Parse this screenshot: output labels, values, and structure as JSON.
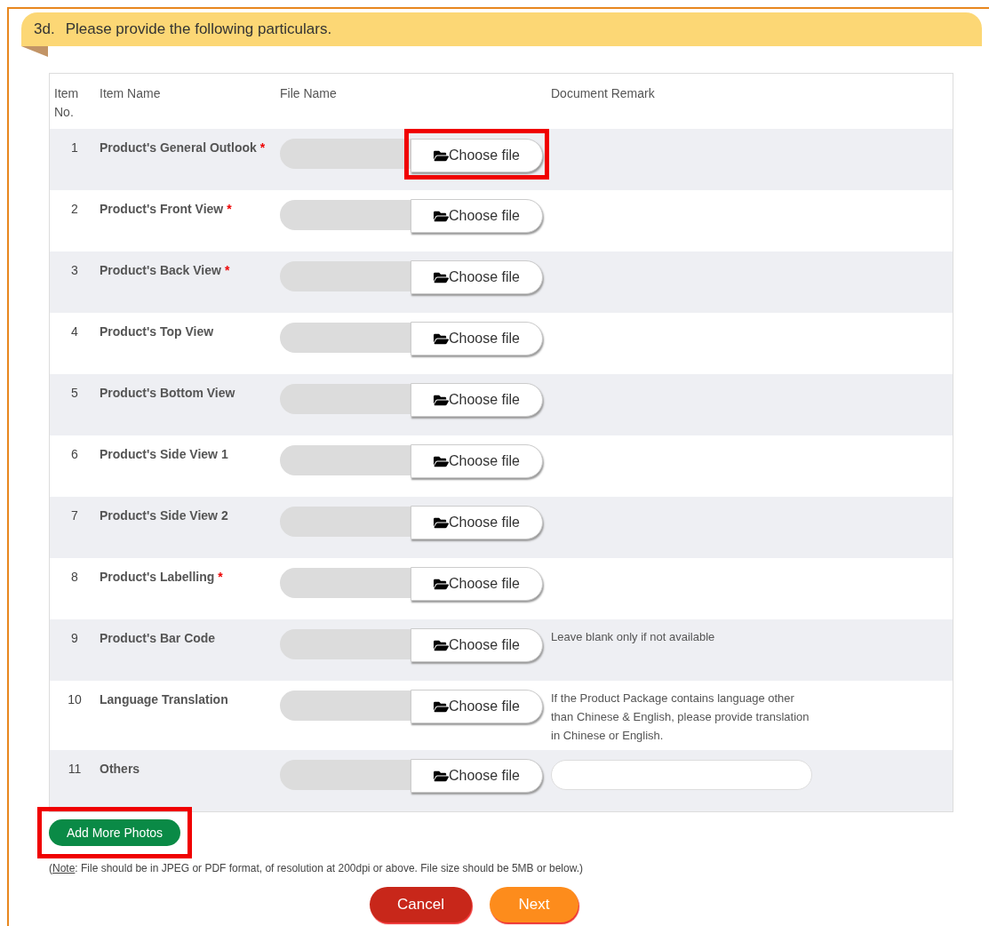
{
  "section": {
    "number": "3d.",
    "title": "Please provide the following particulars."
  },
  "table": {
    "columns": [
      "Item\nNo.",
      "Item Name",
      "File Name",
      "Document Remark"
    ],
    "rows": [
      {
        "no": "1",
        "name": "Product's General Outlook",
        "required": true,
        "button": "Choose file",
        "highlighted": true
      },
      {
        "no": "2",
        "name": "Product's Front View",
        "required": true,
        "button": "Choose file",
        "highlighted": false
      },
      {
        "no": "3",
        "name": "Product's Back View",
        "required": true,
        "button": "Choose file",
        "highlighted": false
      },
      {
        "no": "4",
        "name": "Product's Top View",
        "required": false,
        "button": "Choose file",
        "highlighted": false
      },
      {
        "no": "5",
        "name": "Product's Bottom View",
        "required": false,
        "button": "Choose file",
        "highlighted": false
      },
      {
        "no": "6",
        "name": "Product's Side View 1",
        "required": false,
        "button": "Choose file",
        "highlighted": false
      },
      {
        "no": "7",
        "name": "Product's Side View 2",
        "required": false,
        "button": "Choose file",
        "highlighted": false
      },
      {
        "no": "8",
        "name": "Product's Labelling",
        "required": true,
        "button": "Choose file",
        "highlighted": false
      },
      {
        "no": "9",
        "name": "Product's Bar Code",
        "required": false,
        "button": "Choose file",
        "highlighted": false,
        "remark": {
          "kind": "text",
          "text": "Leave blank only if not available"
        }
      },
      {
        "no": "10",
        "name": "Language Translation",
        "required": false,
        "button": "Choose file",
        "highlighted": false,
        "remark": {
          "kind": "text",
          "text": "If the Product Package contains language other than Chinese & English, please provide translation in Chinese or English."
        }
      },
      {
        "no": "11",
        "name": "Others",
        "required": false,
        "button": "Choose file",
        "highlighted": false,
        "remark": {
          "kind": "field"
        }
      }
    ]
  },
  "required_marker": "*",
  "add_button": {
    "label": "Add More Photos",
    "highlighted": true
  },
  "note": {
    "prefix": "(",
    "label": "Note",
    "text": ": File should be in JPEG or PDF format, of resolution at 200dpi or above. File size should be 5MB or below.)"
  },
  "buttons": [
    {
      "kind": "cancel",
      "label": "Cancel"
    },
    {
      "kind": "next",
      "label": "Next"
    }
  ]
}
